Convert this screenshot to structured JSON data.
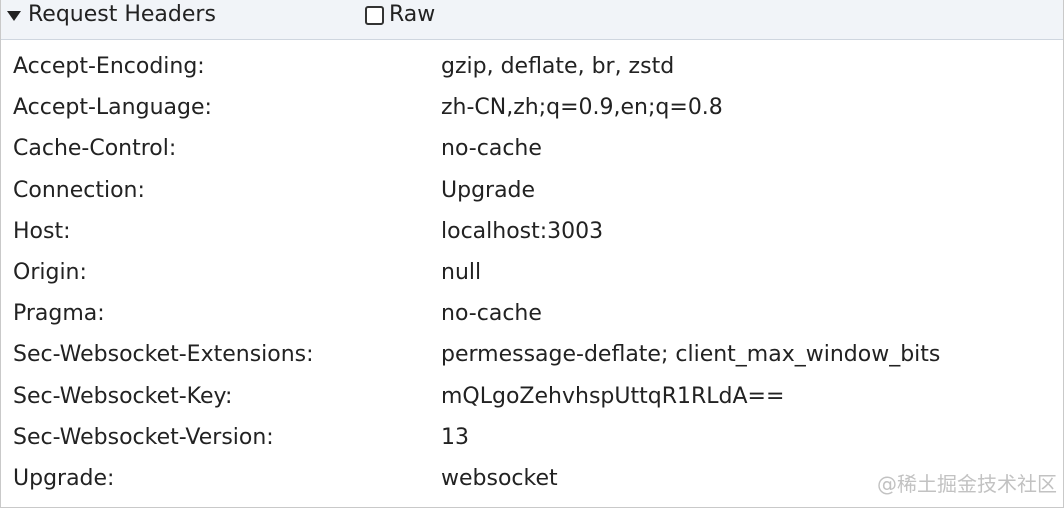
{
  "section": {
    "title": "Request Headers",
    "raw_label": "Raw",
    "raw_checked": false
  },
  "headers": [
    {
      "name": "Accept-Encoding:",
      "value": "gzip, deflate, br, zstd"
    },
    {
      "name": "Accept-Language:",
      "value": "zh-CN,zh;q=0.9,en;q=0.8"
    },
    {
      "name": "Cache-Control:",
      "value": "no-cache"
    },
    {
      "name": "Connection:",
      "value": "Upgrade"
    },
    {
      "name": "Host:",
      "value": "localhost:3003"
    },
    {
      "name": "Origin:",
      "value": "null"
    },
    {
      "name": "Pragma:",
      "value": "no-cache"
    },
    {
      "name": "Sec-Websocket-Extensions:",
      "value": "permessage-deflate; client_max_window_bits"
    },
    {
      "name": "Sec-Websocket-Key:",
      "value": "mQLgoZehvhspUttqR1RLdA=="
    },
    {
      "name": "Sec-Websocket-Version:",
      "value": "13"
    },
    {
      "name": "Upgrade:",
      "value": "websocket"
    }
  ],
  "watermark": "@稀土掘金技术社区"
}
